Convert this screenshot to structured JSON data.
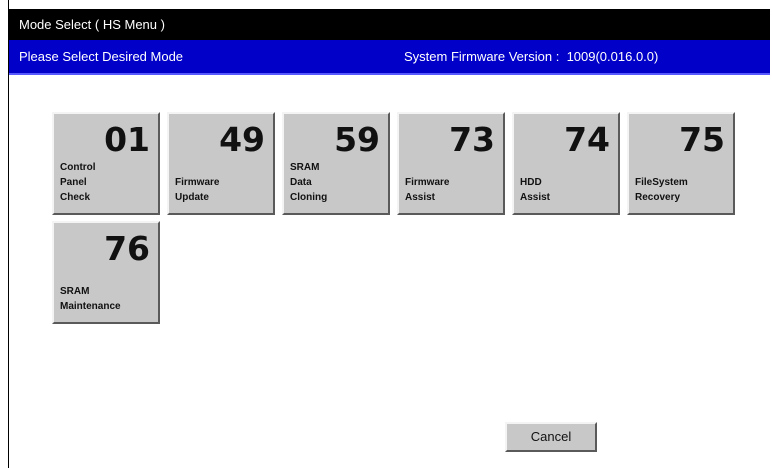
{
  "window": {
    "title": "Mode Select ( HS Menu )"
  },
  "header": {
    "prompt": "Please Select Desired Mode",
    "firmware_label": "System Firmware Version :",
    "firmware_version": "1009(0.016.0.0)"
  },
  "modes": [
    {
      "number": "01",
      "label": "Control\nPanel\nCheck"
    },
    {
      "number": "49",
      "label": "Firmware\nUpdate"
    },
    {
      "number": "59",
      "label": "SRAM\nData\nCloning"
    },
    {
      "number": "73",
      "label": "Firmware\nAssist"
    },
    {
      "number": "74",
      "label": "HDD\nAssist"
    },
    {
      "number": "75",
      "label": "FileSystem\nRecovery"
    },
    {
      "number": "76",
      "label": "SRAM\nMaintenance"
    }
  ],
  "footer": {
    "cancel_label": "Cancel"
  }
}
